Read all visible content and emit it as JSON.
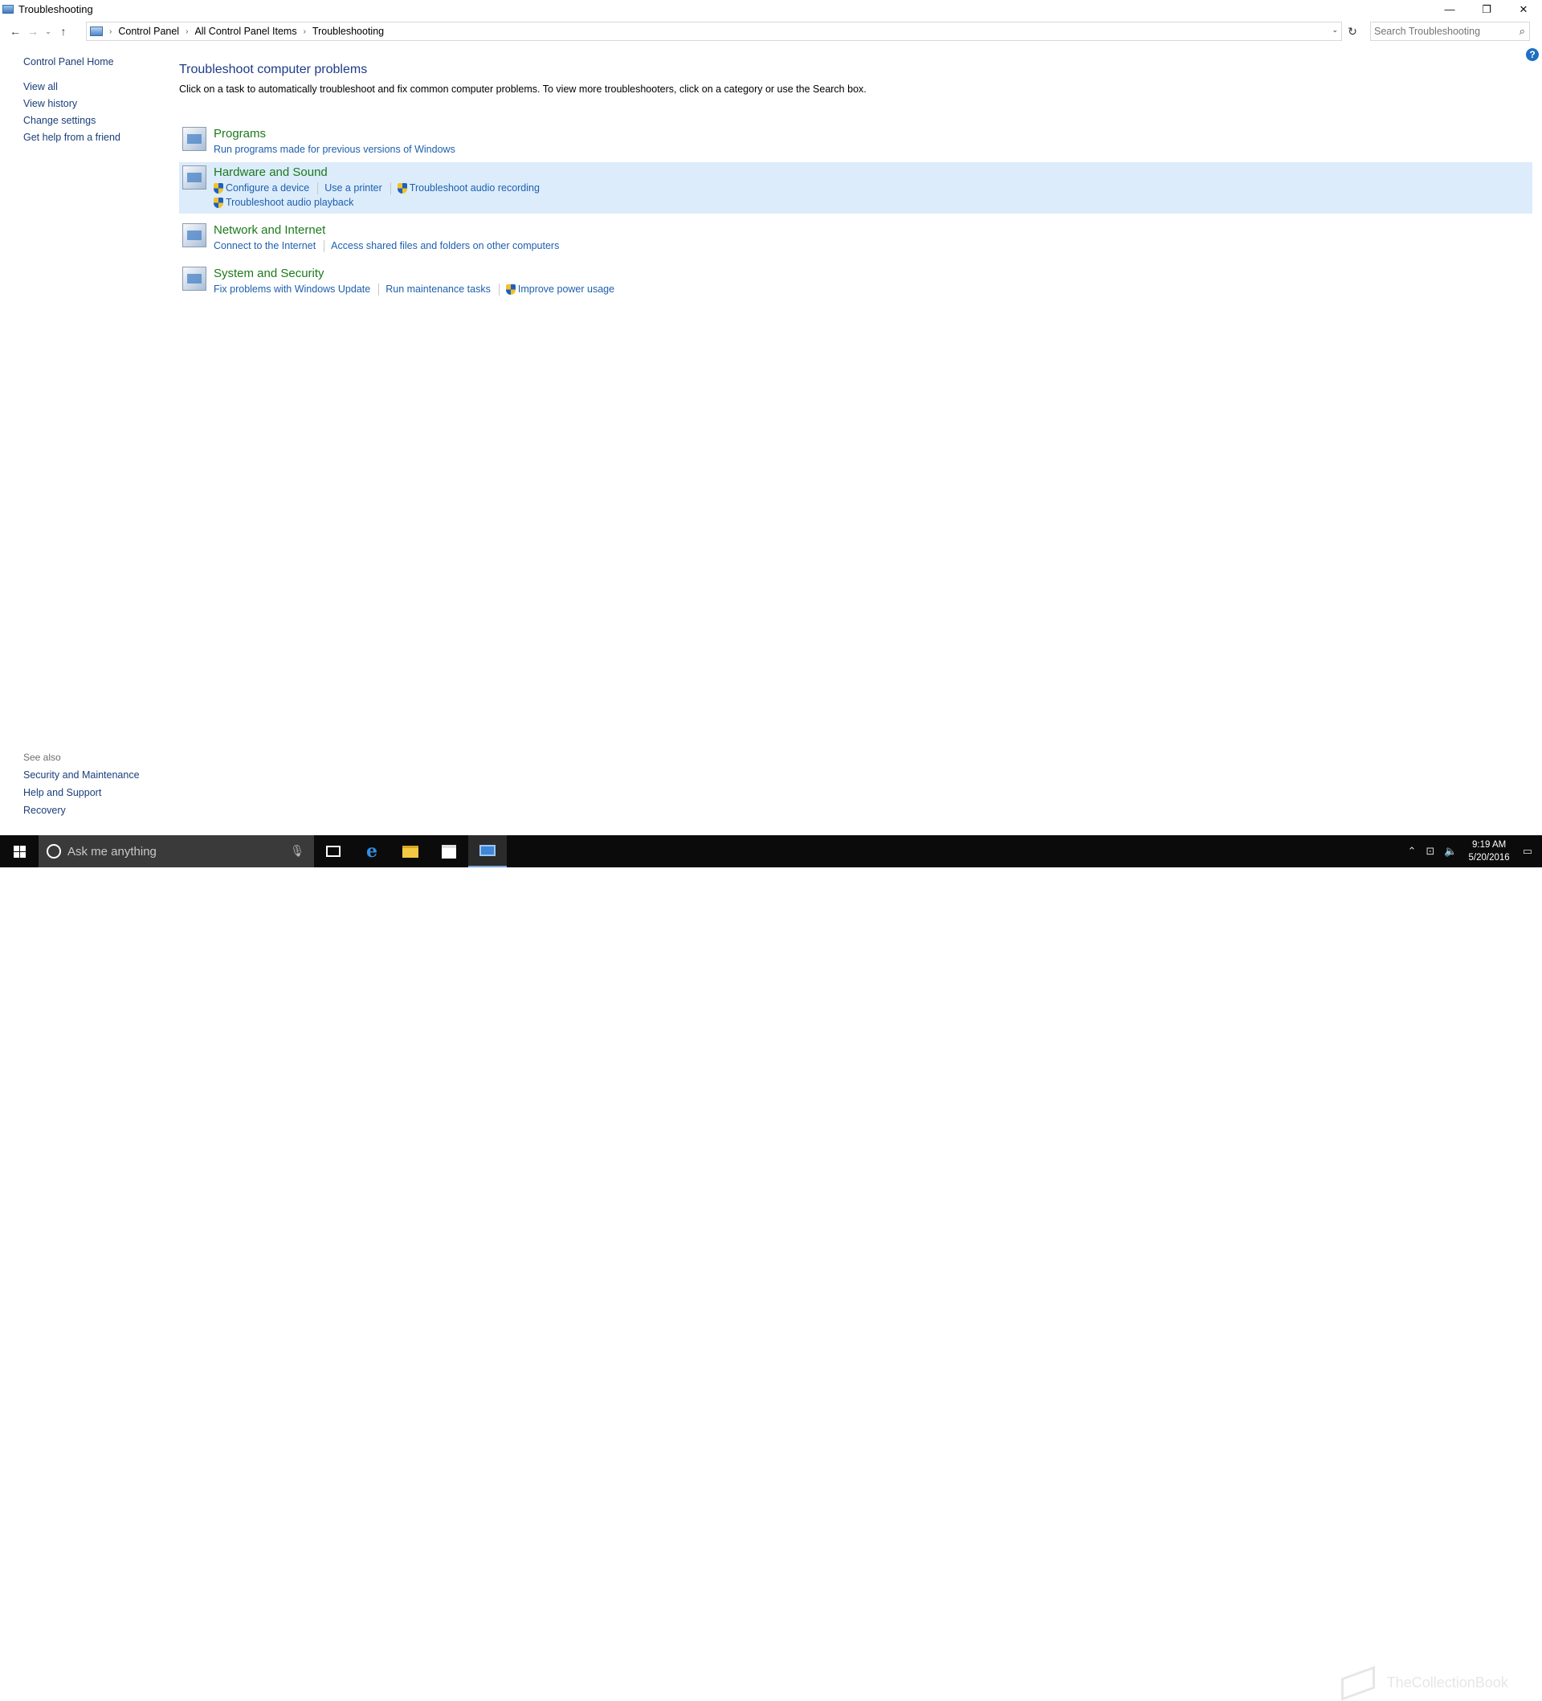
{
  "window": {
    "title": "Troubleshooting",
    "minimize": "—",
    "restore": "❐",
    "close": "✕"
  },
  "nav": {
    "back": "←",
    "forward": "→",
    "recent": "⌄",
    "up": "↑"
  },
  "address": {
    "crumbs": [
      "Control Panel",
      "All Control Panel Items",
      "Troubleshooting"
    ],
    "separator": "›",
    "dropdown": "⌄",
    "refresh": "↻"
  },
  "search": {
    "placeholder": "Search Troubleshooting",
    "icon": "⌕"
  },
  "help_icon": "?",
  "leftnav": {
    "home": "Control Panel Home",
    "items": [
      "View all",
      "View history",
      "Change settings",
      "Get help from a friend"
    ]
  },
  "seealso": {
    "header": "See also",
    "items": [
      "Security and Maintenance",
      "Help and Support",
      "Recovery"
    ]
  },
  "main": {
    "title": "Troubleshoot computer problems",
    "description": "Click on a task to automatically troubleshoot and fix common computer problems. To view more troubleshooters, click on a category or use the Search box.",
    "categories": [
      {
        "title": "Programs",
        "links": [
          {
            "label": "Run programs made for previous versions of Windows",
            "shield": false
          }
        ]
      },
      {
        "title": "Hardware and Sound",
        "links": [
          {
            "label": "Configure a device",
            "shield": true
          },
          {
            "label": "Use a printer",
            "shield": false
          },
          {
            "label": "Troubleshoot audio recording",
            "shield": true
          },
          {
            "label": "Troubleshoot audio playback",
            "shield": true
          }
        ]
      },
      {
        "title": "Network and Internet",
        "links": [
          {
            "label": "Connect to the Internet",
            "shield": false
          },
          {
            "label": "Access shared files and folders on other computers",
            "shield": false
          }
        ]
      },
      {
        "title": "System and Security",
        "links": [
          {
            "label": "Fix problems with Windows Update",
            "shield": false
          },
          {
            "label": "Run maintenance tasks",
            "shield": false
          },
          {
            "label": "Improve power usage",
            "shield": true
          }
        ]
      }
    ]
  },
  "taskbar": {
    "cortana_placeholder": "Ask me anything",
    "mic": "🎙",
    "edge": "e",
    "time": "9:19 AM",
    "date": "5/20/2016",
    "watermark": "TheCollectionBook"
  }
}
